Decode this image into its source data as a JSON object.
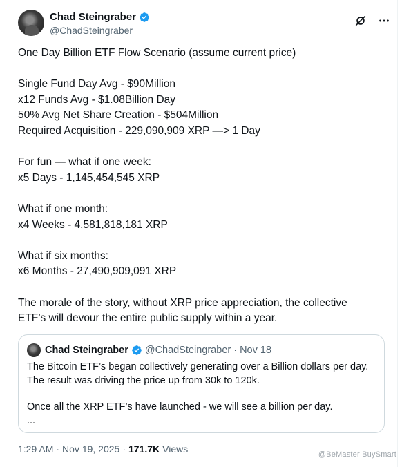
{
  "author": {
    "display_name": "Chad Steingraber",
    "handle": "@ChadSteingraber"
  },
  "tweet": {
    "lines": [
      "One Day Billion ETF Flow Scenario (assume current price)",
      "",
      "Single Fund Day Avg - $90Million",
      "x12 Funds Avg - $1.08Billion Day",
      "50% Avg Net Share Creation - $504Million",
      "Required Acquisition - 229,090,909 XRP —> 1 Day",
      "",
      "For fun — what if one week:",
      "x5 Days - 1,145,454,545 XRP",
      "",
      "What if one month:",
      "x4 Weeks - 4,581,818,181 XRP",
      "",
      "What if six months:",
      "x6 Months - 27,490,909,091 XRP",
      "",
      "The morale of the story, without XRP price appreciation, the collective",
      "ETF’s will devour the entire public supply within a year."
    ]
  },
  "quote": {
    "display_name": "Chad Steingraber",
    "handle": "@ChadSteingraber",
    "date": "· Nov 18",
    "lines": [
      "The Bitcoin ETF’s began collectively generating over a Billion dollars per day.",
      "The result was driving the price up from 30k to 120k.",
      "",
      "Once all the XRP ETF’s have launched - we will see a billion per day.",
      "..."
    ]
  },
  "footer": {
    "time": "1:29 AM",
    "sep1": "·",
    "date": "Nov 19, 2025",
    "sep2": "·",
    "views_count": "171.7K",
    "views_label": "Views"
  },
  "watermark": "@BeMaster BuySmart",
  "colors": {
    "verified": "#1d9bf0",
    "text": "#0f1419",
    "muted": "#536471",
    "border": "#cfd9de"
  }
}
